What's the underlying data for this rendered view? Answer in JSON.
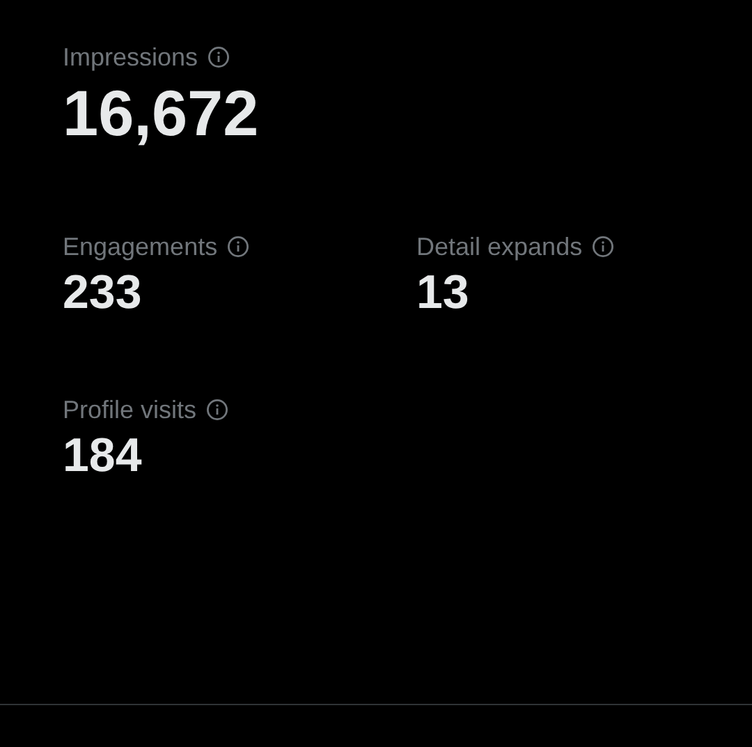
{
  "primary": {
    "label": "Impressions",
    "value": "16,672"
  },
  "metrics": [
    {
      "label": "Engagements",
      "value": "233"
    },
    {
      "label": "Detail expands",
      "value": "13"
    },
    {
      "label": "Profile visits",
      "value": "184"
    }
  ]
}
